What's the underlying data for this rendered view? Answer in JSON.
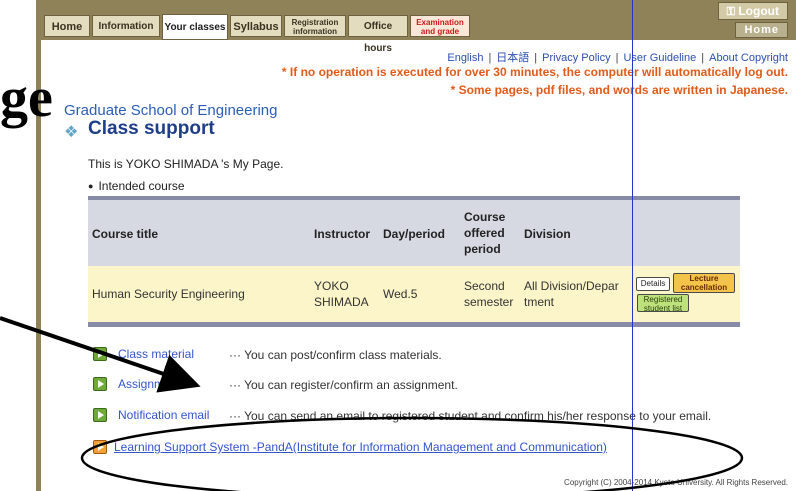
{
  "menu": {
    "tabs": [
      {
        "label": "Home"
      },
      {
        "label": "Information"
      },
      {
        "label": "Your classes"
      },
      {
        "label": "Syllabus"
      },
      {
        "label_line1": "Registration",
        "label_line2": "information"
      },
      {
        "label": "Office hours"
      },
      {
        "label_line1": "Examination",
        "label_line2": "and grade"
      }
    ],
    "logout": "Logout",
    "logout_icon": "key-icon",
    "home_right": "Home"
  },
  "links": {
    "english": "English",
    "japanese": "日本語",
    "privacy": "Privacy Policy",
    "user_guideline": "User Guideline",
    "about_copyright": "About Copyright"
  },
  "notices": {
    "line1": "* If no operation is executed for over 30 minutes, the computer will automatically log out.",
    "line2": "* Some pages, pdf files, and words are written in Japanese."
  },
  "overlay_big_text": "ge",
  "school": "Graduate School of Engineering",
  "section_title": "Class support",
  "mypage": "This is YOKO SHIMADA 's My Page.",
  "intended_course": "Intended course",
  "table": {
    "headers": {
      "course_title": "Course title",
      "instructor": "Instructor",
      "day_period": "Day/period",
      "offered_1": "Course",
      "offered_2": "offered",
      "offered_3": "period",
      "division": "Division"
    },
    "row": {
      "course_title": "Human Security Engineering",
      "instructor_1": "YOKO",
      "instructor_2": "SHIMADA",
      "day_period": "Wed.5",
      "offered_1": "Second",
      "offered_2": "semester",
      "division_1": "All Division/Depar",
      "division_2": "tment"
    },
    "buttons": {
      "details": "Details",
      "lecture_1": "Lecture",
      "lecture_2": "cancellation",
      "registered_1": "Registered",
      "registered_2": "student list"
    }
  },
  "features": [
    {
      "link": "Class material",
      "desc": "··· You can post/confirm class materials."
    },
    {
      "link": "Assignment",
      "desc": "··· You can register/confirm an assignment."
    },
    {
      "link": "Notification email",
      "desc": "··· You can send an email to registered student and confirm his/her response to your email."
    }
  ],
  "panda": "Learning Support System -PandA(Institute for Information Management and Communication)",
  "copyright": "Copyright (C) 2004-2014 Kyoto University. All Rights Reserved.",
  "colors": {
    "menubar": "#8f8259",
    "notice": "#e05a1a",
    "link": "#3355cc",
    "title": "#1f3e8a",
    "table_header": "#d6d8e2",
    "table_row": "#fbf5c9",
    "overlay_line": "#2535cc"
  }
}
